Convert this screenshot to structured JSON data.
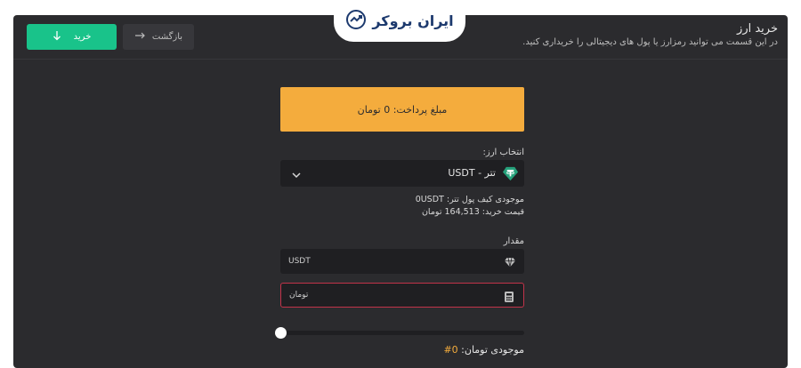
{
  "header": {
    "title": "خرید ارز",
    "subtitle": "در این قسمت می توانید رمزارز یا پول های دیجیتالی را خریداری کنید.",
    "buy_label": "خرید",
    "back_label": "بازگشت"
  },
  "logo": {
    "text": "ایران بروکر"
  },
  "form": {
    "payment_amount": "مبلغ پرداخت: 0 تومان",
    "currency_label": "انتخاب ارز:",
    "currency_selected": "تتر - USDT",
    "wallet_balance": "موجودی کیف پول تتر: 0USDT",
    "buy_price": "قیمت خرید: 164,513 تومان",
    "amount_label": "مقدار",
    "usdt_placeholder": "USDT",
    "toman_placeholder": "تومان",
    "slider_value": 0,
    "toman_balance_label": "موجودی تومان:",
    "toman_balance_value": "0#"
  },
  "colors": {
    "primary_green": "#19c38a",
    "accent_orange": "#f4ac3d",
    "danger_red": "#c2334a",
    "tether_green": "#26a17b",
    "panel_bg": "#2b2b2e",
    "input_bg": "#1f1f22"
  },
  "icons": {
    "buy": "download-arrow-icon",
    "back": "arrow-right-icon",
    "coin": "tether-icon",
    "usdt_field": "diamond-icon",
    "toman_field": "calculator-icon",
    "select": "chevron-down-icon"
  }
}
